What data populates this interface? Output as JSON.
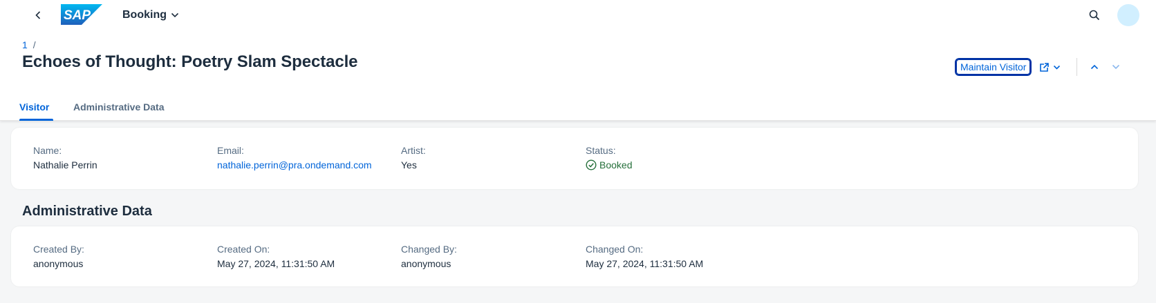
{
  "shell": {
    "app_title": "Booking",
    "logo_text": "SAP"
  },
  "header": {
    "breadcrumb_link": "1",
    "breadcrumb_sep": "/",
    "title": "Echoes of Thought: Poetry Slam Spectacle",
    "maintain_label": "Maintain Visitor"
  },
  "tabs": [
    {
      "label": "Visitor",
      "selected": true
    },
    {
      "label": "Administrative Data",
      "selected": false
    }
  ],
  "visitor": {
    "name_label": "Name:",
    "name_value": "Nathalie Perrin",
    "email_label": "Email:",
    "email_value": "nathalie.perrin@pra.ondemand.com",
    "artist_label": "Artist:",
    "artist_value": "Yes",
    "status_label": "Status:",
    "status_value": "Booked"
  },
  "admin": {
    "section_title": "Administrative Data",
    "created_by_label": "Created By:",
    "created_by_value": "anonymous",
    "created_on_label": "Created On:",
    "created_on_value": "May 27, 2024, 11:31:50 AM",
    "changed_by_label": "Changed By:",
    "changed_by_value": "anonymous",
    "changed_on_label": "Changed On:",
    "changed_on_value": "May 27, 2024, 11:31:50 AM"
  },
  "colors": {
    "brand": "#0064d9",
    "positive": "#256f3a",
    "text": "#1d2d3e",
    "label": "#556b82",
    "background": "#f5f6f7"
  },
  "icons": [
    "back-icon",
    "chevron-down-icon",
    "search-icon",
    "share-icon",
    "chevron-up-icon",
    "success-icon"
  ]
}
